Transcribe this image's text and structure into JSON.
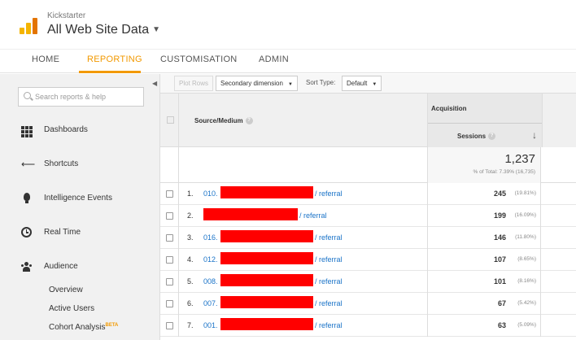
{
  "header": {
    "account": "Kickstarter",
    "property": "All Web Site Data",
    "caret_icon": "caret-down-icon"
  },
  "nav": {
    "tabs": [
      "HOME",
      "REPORTING",
      "CUSTOMISATION",
      "ADMIN"
    ],
    "active": "REPORTING",
    "accent_color": "#f29900"
  },
  "sidebar": {
    "search_placeholder": "Search reports & help",
    "items": [
      {
        "label": "Dashboards",
        "icon": "dashboard-grid-icon"
      },
      {
        "label": "Shortcuts",
        "icon": "shortcut-arrow-icon"
      },
      {
        "label": "Intelligence Events",
        "icon": "lightbulb-icon"
      },
      {
        "label": "Real Time",
        "icon": "clock-icon"
      },
      {
        "label": "Audience",
        "icon": "people-icon"
      }
    ],
    "sub_items": [
      "Overview",
      "Active Users",
      "Cohort Analysis"
    ],
    "beta_label": "BETA"
  },
  "toolbar": {
    "plot_rows": "Plot Rows",
    "secondary_dimension": "Secondary dimension",
    "sort_type_label": "Sort Type:",
    "sort_type_value": "Default"
  },
  "table": {
    "col_source": "Source/Medium",
    "group_acquisition": "Acquisition",
    "col_sessions": "Sessions",
    "sort_icon": "sort-descending-arrow-icon",
    "total_sessions": "1,237",
    "total_pct": "% of Total: 7.39% (16,735)",
    "rows": [
      {
        "idx": "1.",
        "prefix": "010.",
        "medium": "/ referral",
        "sessions": "245",
        "pct": "(19.81%)"
      },
      {
        "idx": "2.",
        "prefix": "",
        "medium": "/ referral",
        "sessions": "199",
        "pct": "(16.09%)"
      },
      {
        "idx": "3.",
        "prefix": "016.",
        "medium": "/ referral",
        "sessions": "146",
        "pct": "(11.80%)"
      },
      {
        "idx": "4.",
        "prefix": "012.",
        "medium": "/ referral",
        "sessions": "107",
        "pct": "(8.65%)"
      },
      {
        "idx": "5.",
        "prefix": "008.",
        "medium": "/ referral",
        "sessions": "101",
        "pct": "(8.16%)"
      },
      {
        "idx": "6.",
        "prefix": "007.",
        "medium": "/ referral",
        "sessions": "67",
        "pct": "(5.42%)"
      },
      {
        "idx": "7.",
        "prefix": "001.",
        "medium": "/ referral",
        "sessions": "63",
        "pct": "(5.09%)"
      }
    ],
    "redaction_color": "#ff0000"
  }
}
